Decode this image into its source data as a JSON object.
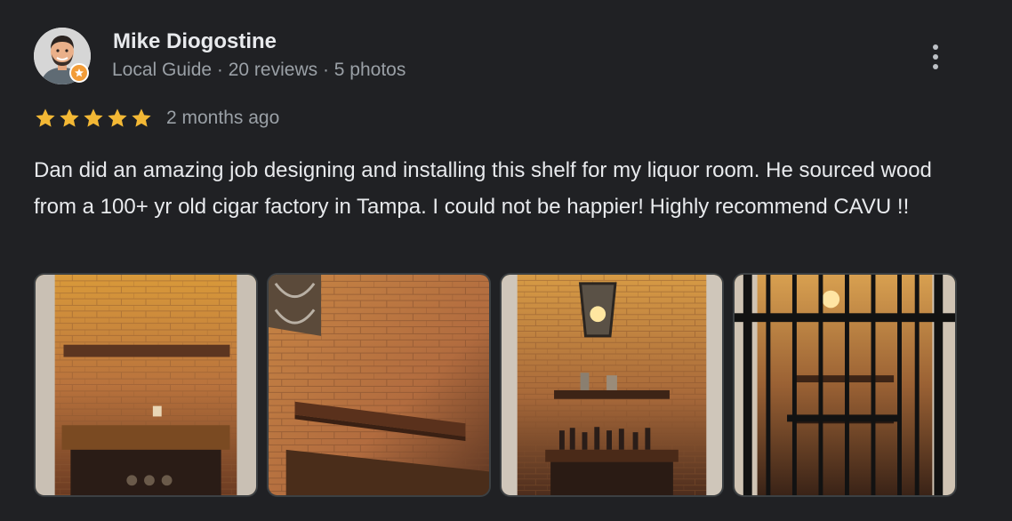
{
  "review": {
    "author_name": "Mike Diogostine",
    "author_meta": "Local Guide · 20 reviews · 5 photos",
    "rating": 5,
    "rating_max": 5,
    "date": "2 months ago",
    "text": "Dan did an amazing job designing and installing this shelf for my liquor room. He sourced wood from a 100+ yr old cigar factory in Tampa. I could not be happier! Highly recommend CAVU !!",
    "photos": [
      {
        "name": "photo-brick-alcove-shelf"
      },
      {
        "name": "photo-shelf-side-view"
      },
      {
        "name": "photo-alcove-with-lantern"
      },
      {
        "name": "photo-alcove-behind-iron-gate"
      }
    ]
  },
  "icons": {
    "more": "more-vert-icon",
    "star": "star-icon",
    "badge": "local-guide-badge-icon"
  },
  "colors": {
    "background": "#202124",
    "text_primary": "#e8eaed",
    "text_secondary": "#9aa0a6",
    "star": "#f3b835",
    "badge": "#f29c38"
  }
}
